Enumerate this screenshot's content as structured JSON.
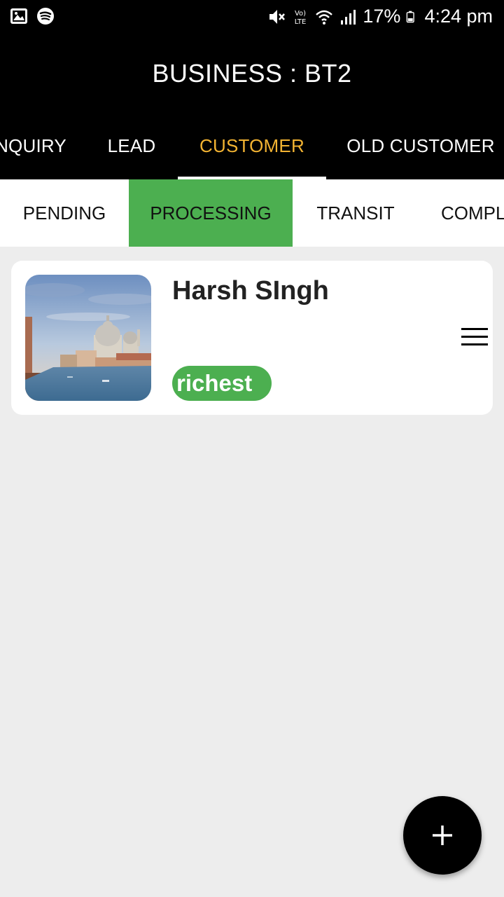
{
  "status_bar": {
    "battery": "17%",
    "time": "4:24 pm",
    "left_icons": [
      "image-icon",
      "spotify-icon"
    ],
    "right_icons": [
      "mute-icon",
      "volte-icon",
      "wifi-icon",
      "signal-icon",
      "battery-icon"
    ]
  },
  "app_bar": {
    "title": "BUSINESS : BT2"
  },
  "primary_tabs": [
    {
      "label": "ENQUIRY",
      "visible_text": "NQUIRY"
    },
    {
      "label": "LEAD"
    },
    {
      "label": "CUSTOMER",
      "active": true
    },
    {
      "label": "OLD CUSTOMER"
    }
  ],
  "secondary_tabs": [
    {
      "label": "PENDING"
    },
    {
      "label": "PROCESSING",
      "active": true
    },
    {
      "label": "TRANSIT"
    },
    {
      "label": "COMPL"
    }
  ],
  "customer_card": {
    "name": "Harsh SIngh",
    "tag": "richest",
    "thumbnail": "venice-photo"
  },
  "fab": {
    "icon": "plus-icon"
  },
  "colors": {
    "accent_tab": "#f2b332",
    "active_chip": "#4caf50",
    "bar": "#000000",
    "background": "#ededed"
  }
}
